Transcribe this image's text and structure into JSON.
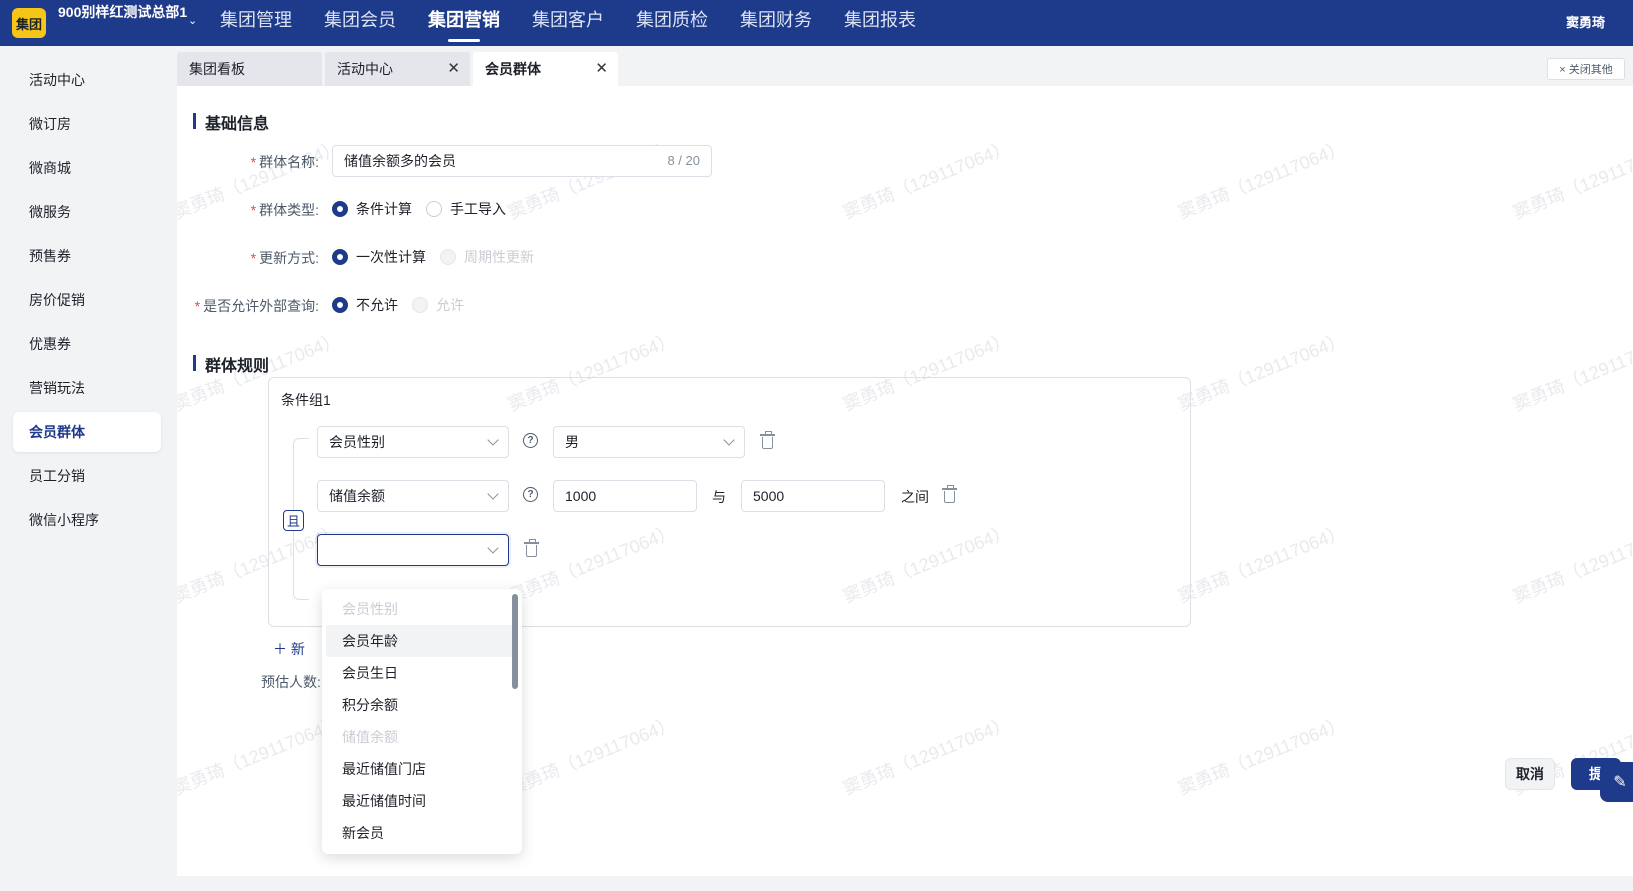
{
  "header": {
    "logo_text": "集团",
    "org_name": "900别样红测试总部1",
    "nav": [
      "集团管理",
      "集团会员",
      "集团营销",
      "集团客户",
      "集团质检",
      "集团财务",
      "集团报表"
    ],
    "active_nav": "集团营销",
    "user": "窦勇琦"
  },
  "sidebar": {
    "items": [
      "活动中心",
      "微订房",
      "微商城",
      "微服务",
      "预售券",
      "房价促销",
      "优惠券",
      "营销玩法",
      "会员群体",
      "员工分销",
      "微信小程序"
    ],
    "active": "会员群体"
  },
  "tabs": {
    "items": [
      {
        "label": "集团看板",
        "closable": false
      },
      {
        "label": "活动中心",
        "closable": true
      },
      {
        "label": "会员群体",
        "closable": true
      }
    ],
    "active": "会员群体",
    "close_others": "× 关闭其他"
  },
  "watermark": "窦勇琦（12911706​4）",
  "basic": {
    "title": "基础信息",
    "name_label": "群体名称:",
    "name_value": "储值余额多的会员",
    "name_counter": "8 / 20",
    "type_label": "群体类型:",
    "type_options": [
      "条件计算",
      "手工导入"
    ],
    "update_label": "更新方式:",
    "update_options": [
      "一次性计算",
      "周期性更新"
    ],
    "external_label": "是否允许外部查询:",
    "external_options": [
      "不允许",
      "允许"
    ]
  },
  "rules": {
    "title": "群体规则",
    "group_title": "条件组1",
    "and_label": "且",
    "row1": {
      "field": "会员性别",
      "value": "男"
    },
    "row2": {
      "field": "储值余额",
      "min": "1000",
      "and_text": "与",
      "max": "5000",
      "between": "之间"
    },
    "row3": {
      "field": ""
    },
    "add_label": "＋ 新",
    "estimate_label": "预估人数:"
  },
  "dropdown": {
    "options": [
      {
        "label": "会员性别",
        "disabled": true
      },
      {
        "label": "会员年龄",
        "disabled": false
      },
      {
        "label": "会员生日",
        "disabled": false
      },
      {
        "label": "积分余额",
        "disabled": false
      },
      {
        "label": "储值余额",
        "disabled": true
      },
      {
        "label": "最近储值门店",
        "disabled": false
      },
      {
        "label": "最近储值时间",
        "disabled": false
      },
      {
        "label": "新会员",
        "disabled": false
      }
    ]
  },
  "footer": {
    "cancel": "取消",
    "submit": "提"
  }
}
